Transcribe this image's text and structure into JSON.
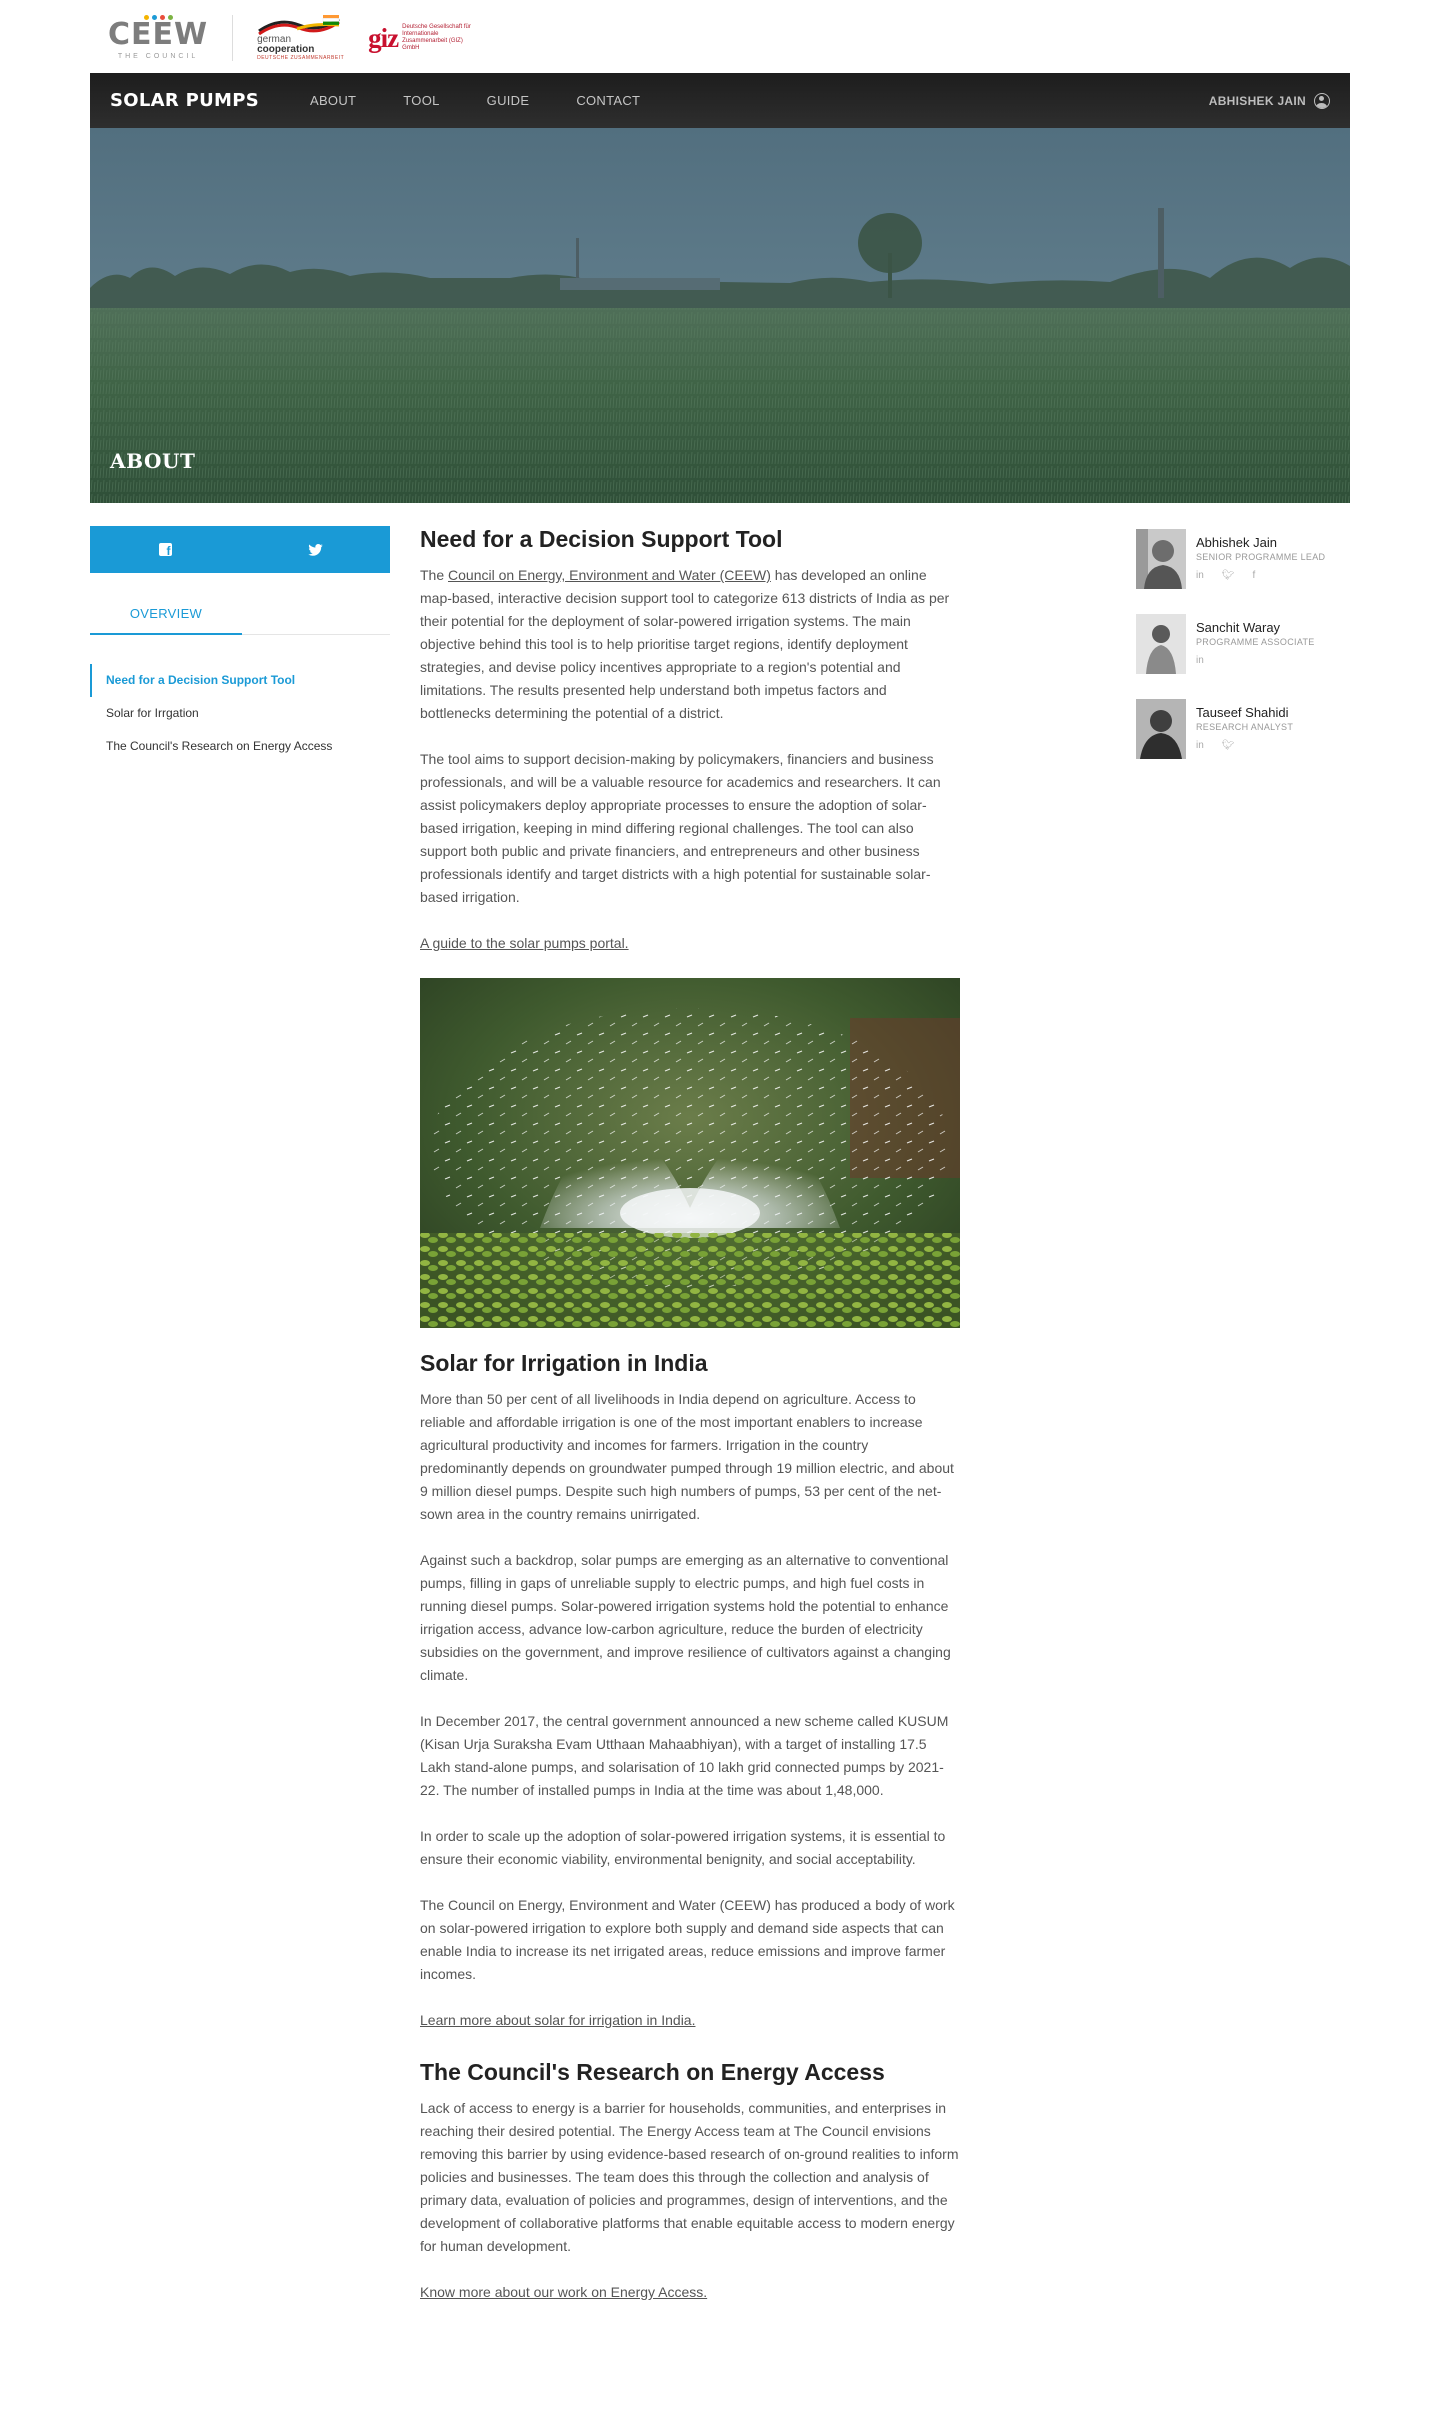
{
  "logos": {
    "ceew_word": "CEEW",
    "ceew_sub": "THE COUNCIL",
    "german_line1": "german",
    "german_line2": "cooperation",
    "german_small": "DEUTSCHE ZUSAMMENARBEIT",
    "giz_mark": "giz",
    "giz_text": "Deutsche Gesellschaft für Internationale Zusammenarbeit (GIZ) GmbH"
  },
  "header": {
    "brand": "SOLAR PUMPS",
    "nav": [
      "ABOUT",
      "TOOL",
      "GUIDE",
      "CONTACT"
    ],
    "user": "ABHISHEK JAIN"
  },
  "hero": {
    "title": "ABOUT"
  },
  "sidebar": {
    "tab": "OVERVIEW",
    "toc": [
      "Need for a Decision Support Tool",
      "Solar for Irrgation",
      "The Council's Research on Energy Access"
    ]
  },
  "main": {
    "s1": {
      "heading": "Need for a Decision Support Tool",
      "p1_pre": "The ",
      "p1_link": "Council on Energy, Environment and Water (CEEW)",
      "p1_post": " has developed an online map-based, interactive decision support tool to categorize 613  districts of India as per their potential for the deployment of solar-powered irrigation systems. The main objective behind this tool is to help prioritise target regions, identify deployment strategies, and devise policy incentives appropriate to a region's potential and limitations. The results presented help understand both impetus factors and bottlenecks determining the potential of a district.",
      "p2": "The tool aims to support decision-making by policymakers, financiers and business professionals, and will be a valuable resource for academics and researchers. It can assist policymakers deploy appropriate processes to ensure the adoption of solar-based irrigation, keeping in mind differing regional challenges. The tool can also support both public and private financiers, and entrepreneurs and other business professionals identify and target districts with a high potential for sustainable solar-based irrigation.",
      "link": "A guide to the solar pumps portal."
    },
    "s2": {
      "heading": "Solar for Irrigation in India",
      "p1": "More than 50 per cent of all livelihoods in India depend on agriculture. Access to reliable and affordable irrigation is one of the most important enablers to increase agricultural productivity and incomes for farmers. Irrigation in the country predominantly depends on groundwater pumped through 19 million electric, and about 9 million diesel pumps. Despite such high numbers of pumps, 53 per cent of the net-sown area in the country remains unirrigated.",
      "p2": "Against such a backdrop, solar pumps are emerging as an alternative to conventional pumps, filling in gaps of unreliable supply to electric pumps, and high fuel costs in running diesel pumps. Solar-powered irrigation systems hold the potential to enhance irrigation access, advance low-carbon agriculture, reduce the burden of electricity subsidies on the government, and improve resilience of cultivators against a changing climate.",
      "p3": "In December 2017, the central government announced a new scheme called KUSUM (Kisan Urja Suraksha Evam Utthaan Mahaabhiyan), with a target of installing 17.5 Lakh stand-alone pumps, and solarisation of 10 lakh grid connected pumps by 2021-22. The number of installed pumps in India at the time was about 1,48,000.",
      "p4": "In order to scale up the adoption of solar-powered irrigation systems, it is essential to ensure their economic viability, environmental benignity, and social acceptability.",
      "p5": "The Council on Energy, Environment and Water (CEEW) has produced a body of work on solar-powered irrigation to explore both supply and demand side aspects that can enable India to increase its net irrigated areas, reduce emissions and improve farmer incomes.",
      "link": "Learn more about solar for irrigation in India."
    },
    "s3": {
      "heading": "The Council's Research on Energy Access",
      "p1": "Lack of access to energy is a barrier for households, communities, and enterprises in reaching their desired potential. The Energy Access team at The Council envisions removing this barrier by using evidence-based research of on-ground realities to inform policies and businesses. The team does this through the collection and analysis of primary data, evaluation of policies and programmes, design of interventions, and the development of collaborative platforms that enable equitable access to modern energy for human development.",
      "link": "Know more about our work on Energy Access."
    }
  },
  "team": [
    {
      "name": "Abhishek Jain",
      "role": "SENIOR PROGRAMME LEAD",
      "socials": [
        "in",
        "tw",
        "f"
      ]
    },
    {
      "name": "Sanchit Waray",
      "role": "PROGRAMME ASSOCIATE",
      "socials": [
        "in"
      ]
    },
    {
      "name": "Tauseef Shahidi",
      "role": "RESEARCH ANALYST",
      "socials": [
        "in",
        "tw"
      ]
    }
  ],
  "colors": {
    "accent": "#1a9ad6",
    "header_bg": "#262626"
  }
}
